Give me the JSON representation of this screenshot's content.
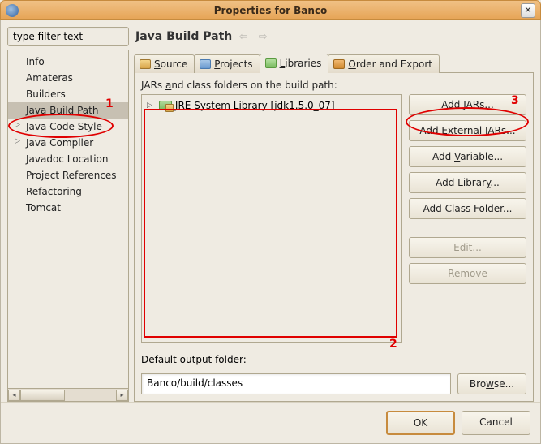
{
  "window": {
    "title": "Properties for Banco"
  },
  "filter": {
    "value": "type filter text"
  },
  "tree": [
    {
      "label": "Info",
      "expandable": false,
      "selected": false
    },
    {
      "label": "Amateras",
      "expandable": false,
      "selected": false
    },
    {
      "label": "Builders",
      "expandable": false,
      "selected": false
    },
    {
      "label": "Java Build Path",
      "expandable": false,
      "selected": true
    },
    {
      "label": "Java Code Style",
      "expandable": true,
      "selected": false
    },
    {
      "label": "Java Compiler",
      "expandable": true,
      "selected": false
    },
    {
      "label": "Javadoc Location",
      "expandable": false,
      "selected": false
    },
    {
      "label": "Project References",
      "expandable": false,
      "selected": false
    },
    {
      "label": "Refactoring",
      "expandable": false,
      "selected": false
    },
    {
      "label": "Tomcat",
      "expandable": false,
      "selected": false
    }
  ],
  "header": {
    "title": "Java Build Path"
  },
  "tabs": {
    "source": "Source",
    "source_u": "S",
    "projects": "Projects",
    "projects_u": "P",
    "libraries": "Libraries",
    "libraries_u": "L",
    "order": "Order and Export",
    "order_u": "O"
  },
  "libs": {
    "section_pre": "JARs ",
    "section_u": "a",
    "section_post": "nd class folders on the build path:",
    "items": [
      {
        "label": "JRE System Library [jdk1.5.0_07]"
      }
    ]
  },
  "buttons": {
    "add_jars_pre": "Add ",
    "add_jars_u": "J",
    "add_jars_post": "ARs...",
    "add_ext_pre": "Add E",
    "add_ext_u": "x",
    "add_ext_post": "ternal JARs...",
    "add_var_pre": "Add ",
    "add_var_u": "V",
    "add_var_post": "ariable...",
    "add_lib_pre": "Add Librar",
    "add_lib_u": "y",
    "add_lib_post": "...",
    "add_class_pre": "Add ",
    "add_class_u": "C",
    "add_class_post": "lass Folder...",
    "edit": "Edit...",
    "edit_u": "E",
    "remove": "Remove",
    "remove_u": "R"
  },
  "output": {
    "label_pre": "Defaul",
    "label_u": "t",
    "label_post": " output folder:",
    "value": "Banco/build/classes",
    "browse_pre": "Bro",
    "browse_u": "w",
    "browse_post": "se..."
  },
  "footer": {
    "ok": "OK",
    "cancel": "Cancel"
  },
  "annotations": {
    "n1": "1",
    "n2": "2",
    "n3": "3"
  },
  "colors": {
    "accent": "#e6a456",
    "highlight": "#e00000"
  }
}
